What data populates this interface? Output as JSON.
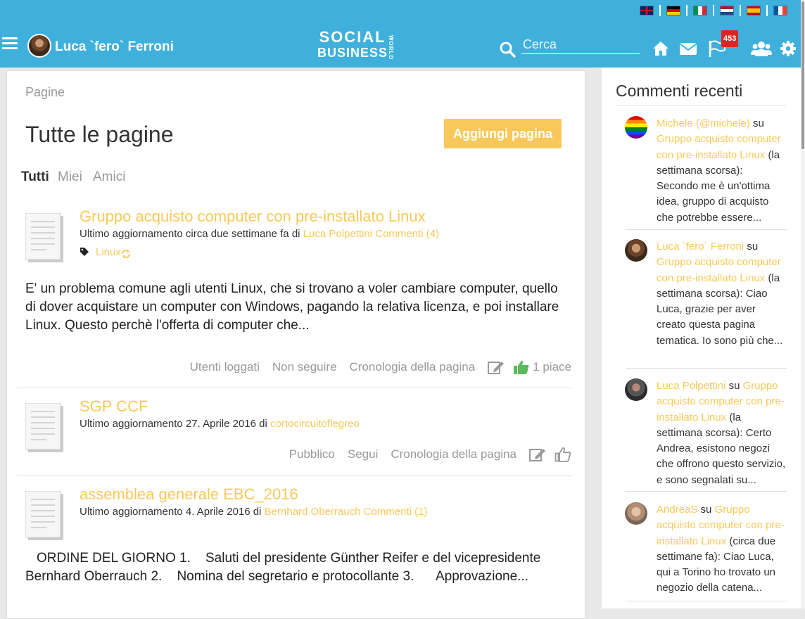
{
  "header": {
    "username": "Luca `fero` Ferroni",
    "logo_line1": "SOCIAL",
    "logo_line2": "BUSINESS",
    "logo_side": "WORLD",
    "search_placeholder": "Cerca",
    "notifications_count": "453",
    "languages": [
      "English",
      "Deutsch",
      "Italiano",
      "Nederlands",
      "Español",
      "Français"
    ],
    "icons": [
      "menu-icon",
      "search-icon",
      "home-icon",
      "mail-icon",
      "flag-icon",
      "users-icon",
      "gear-icon"
    ],
    "bar_color": "#3fb0dc"
  },
  "main": {
    "breadcrumb": "Pagine",
    "title": "Tutte le pagine",
    "add_button": "Aggiungi pagina",
    "filters": [
      "Tutti",
      "Miei",
      "Amici"
    ],
    "active_filter": "Tutti",
    "accent_color": "#f8c95a",
    "items": [
      {
        "title": "Gruppo acquisto computer con pre-installato Linux",
        "meta_prefix": "Ultimo aggiornamento circa due settimane fa di",
        "author": "Luca Polpettini",
        "comments": "Commenti (4)",
        "tag": "Linux",
        "excerpt": "E' un problema comune agli utenti Linux, che si trovano a voler cambiare computer, quello di dover acquistare un computer con Windows, pagando la relativa licenza, e poi installare Linux. Questo perchè l'offerta di computer che...",
        "actions": [
          "Utenti loggati",
          "Non seguire",
          "Cronologia della pagina"
        ],
        "likes": "1 piace"
      },
      {
        "title": "SGP CCF",
        "meta_prefix": "Ultimo aggiornamento 27. Aprile 2016 di",
        "author": "cortocircuitoflegreo",
        "actions": [
          "Pubblico",
          "Segui",
          "Cronologia della pagina"
        ]
      },
      {
        "title": "assemblea generale EBC_2016",
        "meta_prefix": "Ultimo aggiornamento 4. Aprile 2016 di",
        "author": "Bernhard Oberrauch",
        "comments": "Commenti (1)",
        "excerpt": "ORDINE DEL GIORNO 1.    Saluti del presidente Günther Reifer e del vicepresidente Bernhard Oberrauch 2.    Nomina del segretario e protocollante 3.      Approvazione..."
      }
    ]
  },
  "sidebar": {
    "title": "Commenti recenti",
    "connector": "su",
    "comments": [
      {
        "author": "Michele (@michele)",
        "page": "Gruppo acquisto computer con pre-installato Linux",
        "text": "(la settimana scorsa): Secondo me è un'ottima idea, gruppo di acquisto che potrebbe essere..."
      },
      {
        "author": "Luca `fero` Ferroni",
        "page": "Gruppo acquisto computer con pre-installato Linux",
        "text": "(la settimana scorsa): Ciao Luca, grazie per aver creato questa pagina tematica. Io sono più che..."
      },
      {
        "author": "Luca Polpettini",
        "page": "Gruppo acquisto computer con pre-installato Linux",
        "text": "(la settimana scorsa): Certo Andrea, esistono negozi che offrono questo servizio, e sono segnalati su..."
      },
      {
        "author": "AndreaS",
        "page": "Gruppo acquisto computer con pre-installato Linux",
        "text": "(circa due settimane fa): Ciao Luca, qui a Torino ho trovato un negozio della catena..."
      }
    ]
  }
}
